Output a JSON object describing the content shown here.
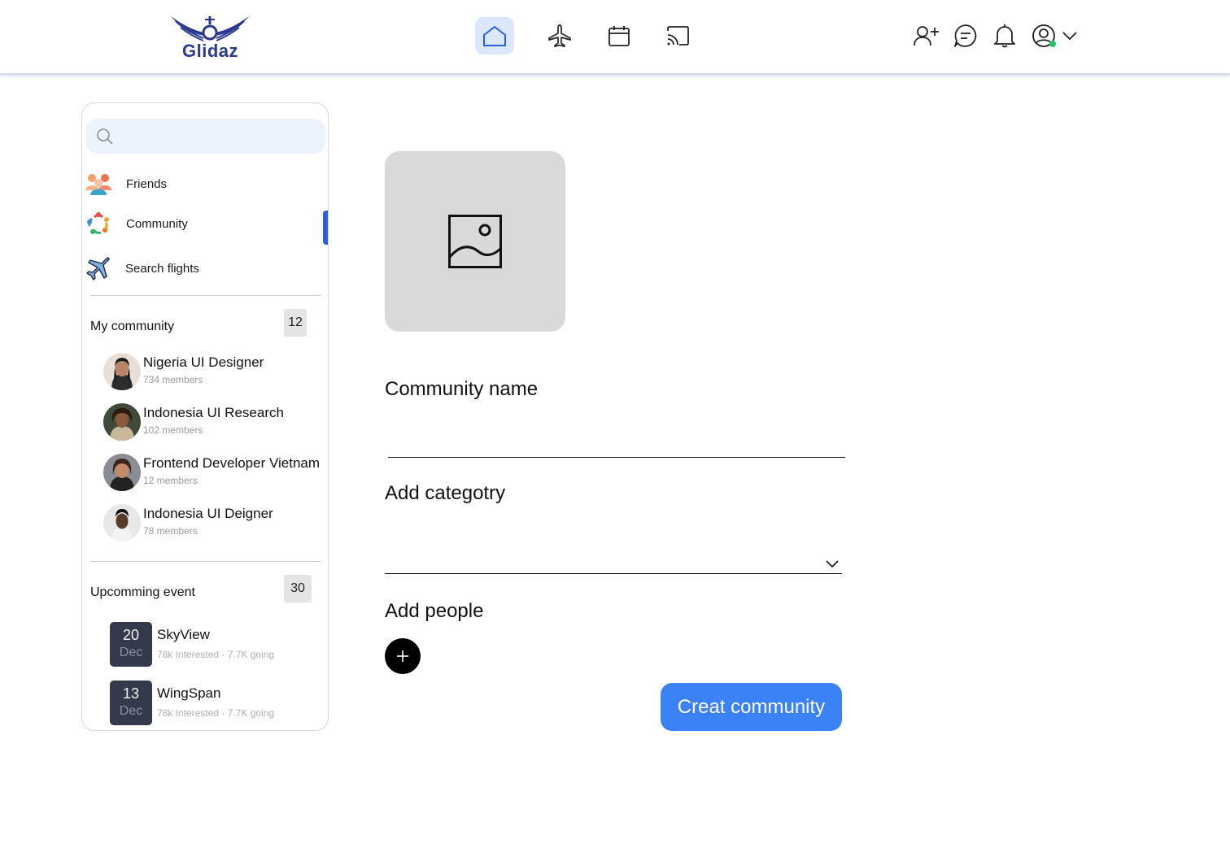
{
  "app": {
    "logo_text": "Glidaz"
  },
  "nav": [
    {
      "icon": "home-icon",
      "active": true
    },
    {
      "icon": "airplane-icon",
      "active": false
    },
    {
      "icon": "calendar-icon",
      "active": false
    },
    {
      "icon": "cast-icon",
      "active": false
    }
  ],
  "header_icons": [
    "add-friend-icon",
    "chat-icon",
    "bell-icon",
    "profile-icon",
    "chevron-down-icon"
  ],
  "colors": {
    "accent": "#3b82f6",
    "active_bar": "#2a5ee8",
    "nav_active_bg": "#dbe8fb",
    "online": "#22c55e",
    "date_bg": "#343a4c"
  },
  "sidebar": {
    "search": {
      "placeholder": "",
      "value": ""
    },
    "menu": [
      {
        "label": "Friends",
        "icon": "friends-icon"
      },
      {
        "label": "Community",
        "icon": "community-icon",
        "active": true
      },
      {
        "label": "Search flights",
        "icon": "plane-icon"
      }
    ],
    "my_community": {
      "title": "My community",
      "count": "12",
      "items": [
        {
          "name": "Nigeria UI Designer",
          "members": "734 members"
        },
        {
          "name": "Indonesia UI Research",
          "members": "102 members"
        },
        {
          "name": "Frontend Developer Vietnam",
          "members": "12 members"
        },
        {
          "name": "Indonesia UI Deigner",
          "members": "78 members"
        }
      ]
    },
    "events": {
      "title": "Upcomming event",
      "count": "30",
      "items": [
        {
          "day": "20",
          "month": "Dec",
          "name": "SkyView",
          "stats": "78k Interested · 7.7K going"
        },
        {
          "day": "13",
          "month": "Dec",
          "name": "WingSpan",
          "stats": "78k Interested · 7.7K going"
        }
      ]
    }
  },
  "form": {
    "image_placeholder_icon": "image-icon",
    "community_name_label": "Community name",
    "community_name_value": "",
    "category_label": "Add categotry",
    "category_value": "",
    "people_label": "Add people",
    "submit_label": "Creat community"
  }
}
